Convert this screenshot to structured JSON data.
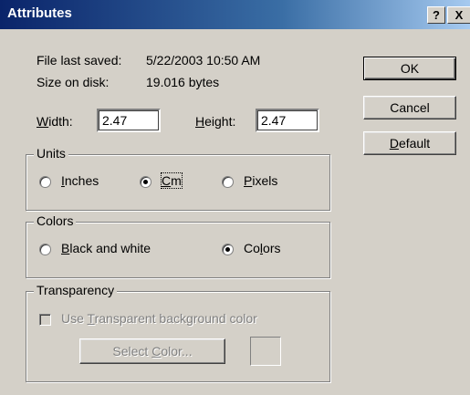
{
  "window": {
    "title": "Attributes",
    "help_glyph": "?",
    "close_glyph": "X"
  },
  "info": {
    "saved_label": "File last saved:",
    "saved_value": "5/22/2003 10:50 AM",
    "size_label": "Size on disk:",
    "size_value": "19.016 bytes"
  },
  "dims": {
    "width_label": {
      "pre": "",
      "key": "W",
      "post": "idth:"
    },
    "width_value": "2.47",
    "height_label": {
      "pre": "",
      "key": "H",
      "post": "eight:"
    },
    "height_value": "2.47"
  },
  "buttons": {
    "ok": "OK",
    "cancel": "Cancel",
    "default": {
      "pre": "",
      "key": "D",
      "post": "efault"
    }
  },
  "units": {
    "legend": "Units",
    "options": [
      {
        "pre": "",
        "key": "I",
        "post": "nches",
        "selected": false
      },
      {
        "pre": "",
        "key": "C",
        "post": "m",
        "selected": true
      },
      {
        "pre": "",
        "key": "P",
        "post": "ixels",
        "selected": false
      }
    ]
  },
  "colors": {
    "legend": "Colors",
    "options": [
      {
        "pre": "",
        "key": "B",
        "post": "lack and white",
        "selected": false
      },
      {
        "pre": "Co",
        "key": "l",
        "post": "ors",
        "selected": true
      }
    ]
  },
  "transparency": {
    "legend": "Transparency",
    "checkbox": {
      "pre": "Use ",
      "key": "T",
      "post": "ransparent background color",
      "checked": false,
      "enabled": false
    },
    "select_color": {
      "pre": "Select ",
      "key": "C",
      "post": "olor...",
      "enabled": false
    }
  }
}
